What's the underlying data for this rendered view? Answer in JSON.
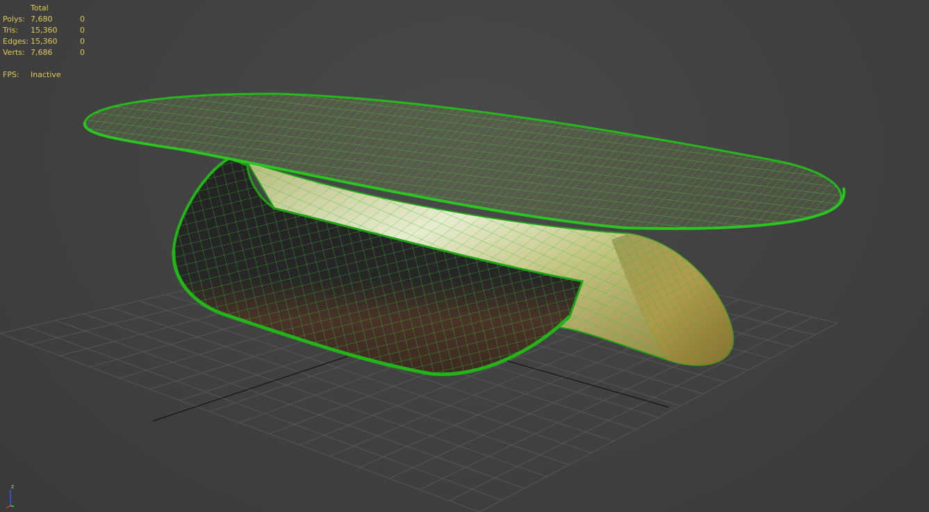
{
  "viewport_stats": {
    "header": "Total",
    "rows": [
      {
        "label": "Polys:",
        "total": "7,680",
        "selected": "0"
      },
      {
        "label": "Tris:",
        "total": "15,360",
        "selected": "0"
      },
      {
        "label": "Edges:",
        "total": "15,360",
        "selected": "0"
      },
      {
        "label": "Verts:",
        "total": "7,686",
        "selected": "0"
      }
    ],
    "fps_label": "FPS:",
    "fps_value": "Inactive"
  },
  "axis_gizmo": {
    "z_label": "z"
  },
  "colors": {
    "background": "#444444",
    "stats_text": "#e3c95a",
    "wire_selected": "#22c01a",
    "grid_line": "#5a5a5a",
    "axis_line": "#141414"
  }
}
